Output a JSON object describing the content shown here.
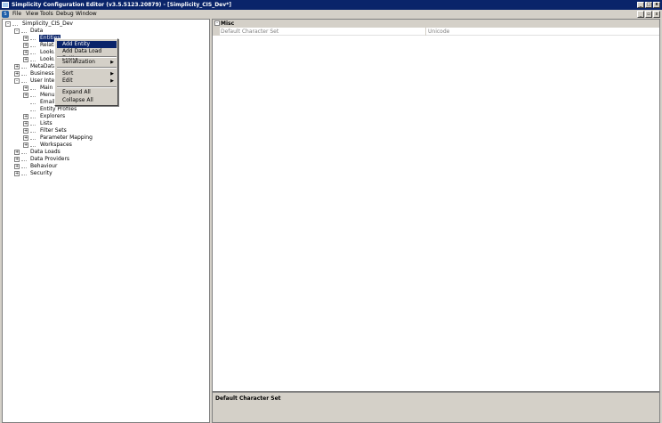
{
  "window": {
    "title": "Simplicity Configuration Editor (v3.5.5123.20879) - [Simplicity_CIS_Dev*]",
    "min_glyph": "_",
    "max_glyph": "□",
    "close_glyph": "x",
    "mdi_min_glyph": "_",
    "mdi_restore_glyph": "▫",
    "mdi_close_glyph": "x"
  },
  "menubar": {
    "items": [
      "File",
      "View",
      "Tools",
      "Debug",
      "Window"
    ]
  },
  "tree": {
    "root": "Simplicity_CIS_Dev",
    "nodes": [
      {
        "label": "Data",
        "expander": "-"
      },
      {
        "label": "Entities",
        "expander": "+"
      },
      {
        "label": "Relatio",
        "expander": "+"
      },
      {
        "label": "Lookup",
        "expander": "+"
      },
      {
        "label": "Lookup",
        "expander": "+"
      },
      {
        "label": "MetaData",
        "expander": "+"
      },
      {
        "label": "Business P",
        "expander": "+"
      },
      {
        "label": "User Interfa",
        "expander": "-"
      },
      {
        "label": "Main M",
        "expander": "+"
      },
      {
        "label": "Menus",
        "expander": "+"
      },
      {
        "label": "Email T",
        "expander": ""
      },
      {
        "label": "Entity Profiles",
        "expander": ""
      },
      {
        "label": "Explorers",
        "expander": "+"
      },
      {
        "label": "Lists",
        "expander": "+"
      },
      {
        "label": "Filter Sets",
        "expander": "+"
      },
      {
        "label": "Parameter Mapping",
        "expander": "+"
      },
      {
        "label": "Workspaces",
        "expander": "+"
      },
      {
        "label": "Data Loads",
        "expander": "+"
      },
      {
        "label": "Data Providers",
        "expander": "+"
      },
      {
        "label": "Behaviour",
        "expander": "+"
      },
      {
        "label": "Security",
        "expander": "+"
      }
    ]
  },
  "context_menu": {
    "items": [
      {
        "label": "Add Entity",
        "submenu": false
      },
      {
        "label": "Add Data Load Entity",
        "submenu": false
      },
      {
        "label": "Serialization",
        "submenu": true
      },
      {
        "label": "Sort",
        "submenu": true
      },
      {
        "label": "Edit",
        "submenu": true
      },
      {
        "label": "Expand All",
        "submenu": false
      },
      {
        "label": "Collapse All",
        "submenu": false
      }
    ],
    "arrow_glyph": "▶"
  },
  "property_grid": {
    "category": "Misc",
    "category_expander": "-",
    "property_name": "Default Character Set",
    "property_value": "Unicode"
  },
  "description_pane": {
    "title": "Default Character Set"
  },
  "colors": {
    "title_bar": "#0a246a",
    "selection": "#0a246a",
    "chrome": "#d4d0c8"
  }
}
